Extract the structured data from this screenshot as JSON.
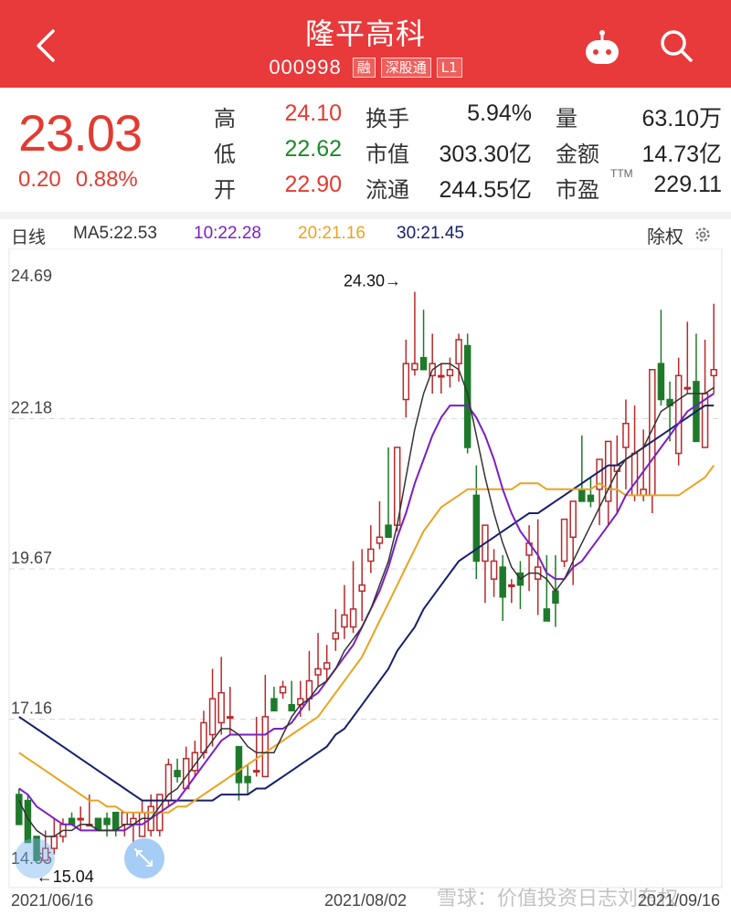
{
  "header": {
    "title": "隆平高科",
    "code": "000998",
    "tags": [
      "融",
      "深股通",
      "L1"
    ]
  },
  "quote": {
    "price": "23.03",
    "change": "0.20",
    "change_pct": "0.88%",
    "high_label": "高",
    "high": "24.10",
    "low_label": "低",
    "low": "22.62",
    "open_label": "开",
    "open": "22.90",
    "turnover_label": "换手",
    "turnover": "5.94%",
    "mcap_label": "市值",
    "mcap": "303.30亿",
    "float_label": "流通",
    "float": "244.55亿",
    "vol_label": "量",
    "vol": "63.10万",
    "amount_label": "金额",
    "amount": "14.73亿",
    "pe_label": "市盈",
    "pe_tag": "TTM",
    "pe": "229.11"
  },
  "ma_bar": {
    "period": "日线",
    "ma5": "MA5:22.53",
    "ma10": "10:22.28",
    "ma20": "20:21.16",
    "ma30": "30:21.45",
    "adjust": "除权"
  },
  "colors": {
    "up": "#b9282b",
    "down": "#1e7a2a",
    "ma5": "#333333",
    "ma10": "#7b1fc4",
    "ma20": "#e8a422",
    "ma30": "#16206b",
    "header": "#e8393b"
  },
  "chart_data": {
    "type": "candlestick",
    "y_ticks": [
      "24.69",
      "22.18",
      "19.67",
      "17.16",
      "14.65"
    ],
    "ylim": [
      14.65,
      24.69
    ],
    "x_labels": [
      "2021/06/16",
      "2021/08/02",
      "2021/09/16"
    ],
    "max_label": "24.30→",
    "min_label": "←15.04",
    "candles": [
      [
        15.9,
        16.0,
        15.8,
        15.4
      ],
      [
        15.8,
        15.9,
        15.2,
        15.1
      ],
      [
        15.2,
        15.2,
        14.9,
        14.8
      ],
      [
        14.8,
        15.3,
        14.8,
        15.0
      ],
      [
        15.0,
        15.5,
        14.9,
        15.2
      ],
      [
        15.2,
        15.5,
        15.1,
        15.4
      ],
      [
        15.5,
        15.6,
        15.4,
        15.4
      ],
      [
        15.5,
        15.7,
        15.3,
        15.5
      ],
      [
        15.4,
        15.9,
        15.4,
        15.4
      ],
      [
        15.5,
        15.5,
        15.4,
        15.3
      ],
      [
        15.5,
        15.6,
        15.2,
        15.4
      ],
      [
        15.6,
        15.6,
        15.2,
        15.3
      ],
      [
        15.4,
        15.6,
        15.2,
        15.6
      ],
      [
        15.4,
        15.6,
        15.1,
        15.5
      ],
      [
        15.2,
        15.8,
        15.2,
        15.6
      ],
      [
        15.3,
        15.9,
        15.2,
        15.7
      ],
      [
        15.3,
        15.9,
        15.2,
        15.9
      ],
      [
        15.8,
        16.5,
        15.7,
        16.4
      ],
      [
        16.3,
        16.5,
        16.1,
        16.2
      ],
      [
        16.0,
        16.7,
        16.0,
        16.5
      ],
      [
        16.3,
        16.8,
        16.2,
        16.6
      ],
      [
        16.6,
        17.3,
        16.5,
        17.1
      ],
      [
        16.9,
        18.0,
        16.7,
        17.5
      ],
      [
        17.1,
        18.2,
        16.9,
        17.6
      ],
      [
        17.2,
        17.7,
        16.9,
        17.2
      ],
      [
        16.7,
        16.7,
        15.8,
        16.1
      ],
      [
        16.2,
        16.4,
        15.9,
        16.1
      ],
      [
        16.3,
        17.2,
        16.2,
        16.3
      ],
      [
        16.2,
        17.9,
        16.2,
        17.2
      ],
      [
        17.5,
        17.7,
        17.3,
        17.3
      ],
      [
        17.6,
        17.8,
        17.5,
        17.7
      ],
      [
        17.4,
        17.8,
        17.3,
        17.3
      ],
      [
        17.4,
        17.8,
        17.2,
        17.5
      ],
      [
        17.5,
        18.3,
        17.3,
        17.8
      ],
      [
        17.9,
        18.6,
        17.7,
        18.0
      ],
      [
        18.0,
        18.4,
        17.8,
        18.1
      ],
      [
        18.5,
        19.0,
        18.3,
        18.6
      ],
      [
        18.7,
        19.4,
        18.5,
        18.9
      ],
      [
        18.7,
        19.8,
        18.6,
        19.0
      ],
      [
        19.3,
        20.0,
        18.8,
        19.4
      ],
      [
        19.8,
        20.4,
        19.6,
        20.0
      ],
      [
        20.1,
        20.8,
        20.0,
        20.2
      ],
      [
        20.4,
        21.7,
        20.2,
        20.2
      ],
      [
        20.4,
        21.5,
        20.3,
        21.7
      ],
      [
        22.5,
        23.5,
        22.2,
        23.1
      ],
      [
        23.0,
        24.3,
        22.9,
        23.1
      ],
      [
        23.2,
        24.0,
        23.0,
        23.0
      ],
      [
        22.9,
        23.6,
        22.6,
        23.1
      ],
      [
        22.9,
        23.1,
        22.6,
        22.9
      ],
      [
        22.9,
        23.2,
        22.7,
        23.0
      ],
      [
        23.1,
        23.6,
        22.8,
        23.5
      ],
      [
        23.4,
        23.6,
        21.6,
        21.7
      ],
      [
        20.9,
        21.4,
        19.5,
        19.8
      ],
      [
        19.8,
        20.4,
        19.1,
        20.4
      ],
      [
        19.5,
        20.0,
        19.2,
        19.8
      ],
      [
        19.7,
        19.9,
        18.8,
        19.2
      ],
      [
        19.4,
        19.5,
        19.1,
        19.4
      ],
      [
        19.6,
        19.8,
        19.0,
        19.4
      ],
      [
        19.9,
        20.4,
        19.3,
        20.1
      ],
      [
        19.5,
        20.5,
        18.9,
        19.7
      ],
      [
        19.0,
        19.9,
        18.9,
        18.8
      ],
      [
        19.3,
        19.9,
        18.7,
        19.1
      ],
      [
        19.8,
        20.4,
        19.7,
        20.5
      ],
      [
        20.2,
        20.8,
        19.4,
        20.8
      ],
      [
        21.0,
        21.9,
        20.8,
        20.8
      ],
      [
        20.9,
        21.2,
        20.7,
        20.8
      ],
      [
        21.0,
        21.5,
        20.4,
        21.5
      ],
      [
        20.8,
        21.6,
        20.4,
        21.8
      ],
      [
        21.3,
        21.9,
        20.6,
        21.4
      ],
      [
        21.7,
        22.5,
        21.0,
        22.1
      ],
      [
        20.9,
        22.4,
        20.8,
        21.6
      ],
      [
        20.9,
        22.0,
        20.8,
        21.0
      ],
      [
        20.9,
        22.8,
        20.6,
        23.0
      ],
      [
        23.1,
        24.0,
        22.4,
        22.5
      ],
      [
        22.5,
        22.8,
        21.8,
        22.4
      ],
      [
        21.6,
        23.2,
        21.4,
        22.9
      ],
      [
        22.7,
        23.8,
        22.6,
        22.7
      ],
      [
        22.8,
        23.6,
        21.8,
        21.8
      ],
      [
        21.7,
        23.5,
        21.7,
        22.6
      ],
      [
        22.9,
        24.1,
        22.6,
        23.0
      ]
    ],
    "ma5": [
      15.8,
      15.5,
      15.3,
      15.2,
      15.2,
      15.3,
      15.3,
      15.4,
      15.4,
      15.3,
      15.3,
      15.3,
      15.4,
      15.4,
      15.5,
      15.5,
      15.7,
      15.9,
      16.0,
      16.2,
      16.4,
      16.6,
      16.8,
      17.0,
      17.0,
      16.9,
      16.7,
      16.6,
      16.6,
      16.6,
      16.9,
      17.2,
      17.4,
      17.5,
      17.7,
      17.8,
      18.0,
      18.3,
      18.5,
      18.7,
      19.0,
      19.4,
      19.8,
      20.4,
      21.2,
      22.0,
      22.6,
      23.0,
      23.1,
      23.1,
      23.0,
      22.6,
      21.9,
      21.2,
      20.6,
      20.1,
      19.7,
      19.5,
      19.6,
      19.6,
      19.5,
      19.3,
      19.5,
      19.8,
      20.1,
      20.4,
      20.7,
      21.0,
      21.3,
      21.5,
      21.6,
      21.7,
      22.0,
      22.3,
      22.4,
      22.5,
      22.6,
      22.6,
      22.6,
      22.7
    ],
    "ma10": [
      16.0,
      15.9,
      15.7,
      15.6,
      15.5,
      15.4,
      15.4,
      15.3,
      15.3,
      15.3,
      15.3,
      15.3,
      15.3,
      15.4,
      15.4,
      15.5,
      15.6,
      15.7,
      15.8,
      16.0,
      16.2,
      16.4,
      16.6,
      16.8,
      16.9,
      16.9,
      16.9,
      16.9,
      16.9,
      17.0,
      17.0,
      17.1,
      17.3,
      17.5,
      17.6,
      17.8,
      18.0,
      18.2,
      18.4,
      18.7,
      19.0,
      19.3,
      19.7,
      20.2,
      20.6,
      21.1,
      21.5,
      21.9,
      22.2,
      22.4,
      22.4,
      22.4,
      22.2,
      21.9,
      21.5,
      21.0,
      20.6,
      20.3,
      20.1,
      19.9,
      19.6,
      19.5,
      19.5,
      19.7,
      19.8,
      20.0,
      20.2,
      20.4,
      20.6,
      20.9,
      21.1,
      21.3,
      21.5,
      21.7,
      21.9,
      22.1,
      22.3,
      22.4,
      22.5,
      22.6
    ],
    "ma20": [
      16.6,
      16.5,
      16.4,
      16.3,
      16.2,
      16.1,
      16.0,
      15.9,
      15.8,
      15.8,
      15.7,
      15.7,
      15.6,
      15.6,
      15.6,
      15.6,
      15.6,
      15.6,
      15.7,
      15.7,
      15.8,
      15.9,
      16.0,
      16.1,
      16.2,
      16.3,
      16.4,
      16.5,
      16.6,
      16.7,
      16.8,
      16.9,
      17.0,
      17.1,
      17.2,
      17.4,
      17.6,
      17.8,
      18.0,
      18.2,
      18.5,
      18.8,
      19.1,
      19.4,
      19.7,
      20.0,
      20.3,
      20.5,
      20.7,
      20.8,
      20.9,
      21.0,
      21.0,
      21.0,
      21.0,
      21.0,
      21.0,
      21.1,
      21.1,
      21.1,
      21.0,
      21.0,
      21.0,
      21.0,
      21.0,
      21.0,
      21.1,
      21.0,
      21.0,
      20.9,
      20.9,
      20.9,
      20.9,
      20.9,
      20.9,
      20.9,
      21.0,
      21.1,
      21.2,
      21.4
    ],
    "ma30": [
      17.2,
      17.1,
      17.0,
      16.9,
      16.8,
      16.7,
      16.6,
      16.5,
      16.4,
      16.3,
      16.2,
      16.1,
      16.0,
      15.9,
      15.8,
      15.8,
      15.8,
      15.8,
      15.8,
      15.8,
      15.8,
      15.8,
      15.8,
      15.9,
      15.9,
      15.9,
      15.9,
      16.0,
      16.0,
      16.1,
      16.2,
      16.3,
      16.4,
      16.5,
      16.6,
      16.7,
      16.9,
      17.0,
      17.2,
      17.4,
      17.6,
      17.8,
      18.0,
      18.3,
      18.5,
      18.7,
      19.0,
      19.2,
      19.4,
      19.6,
      19.8,
      19.9,
      20.0,
      20.1,
      20.2,
      20.3,
      20.4,
      20.5,
      20.6,
      20.6,
      20.7,
      20.8,
      20.9,
      21.0,
      21.1,
      21.2,
      21.3,
      21.4,
      21.4,
      21.5,
      21.6,
      21.7,
      21.8,
      21.9,
      22.0,
      22.1,
      22.2,
      22.3,
      22.4,
      22.4
    ]
  },
  "watermark": "雪球：价值投资日志刘东权"
}
